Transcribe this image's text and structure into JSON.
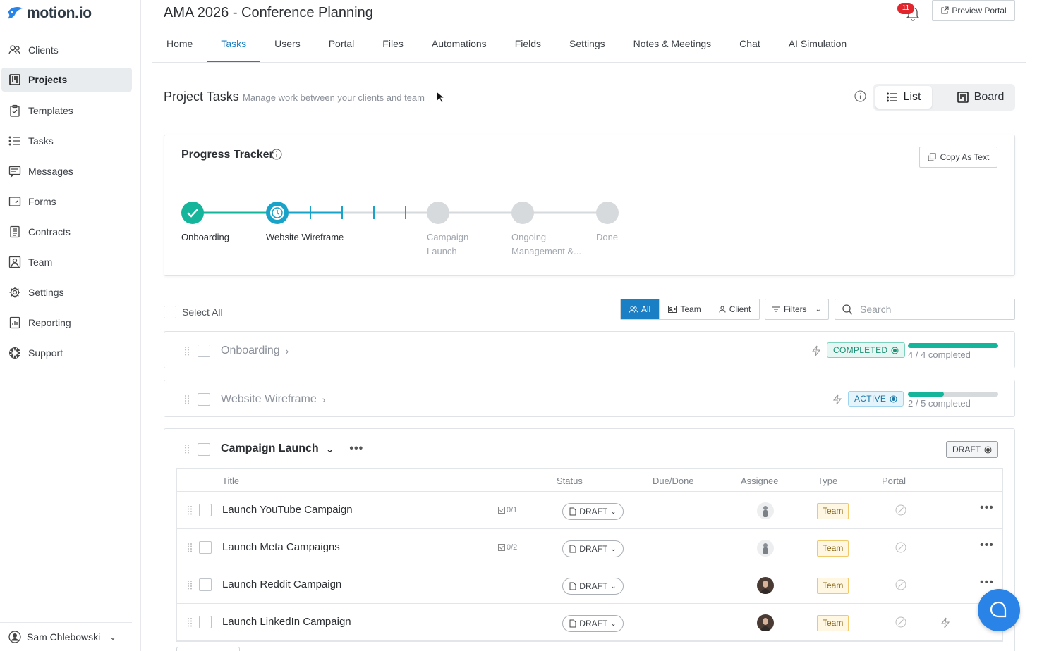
{
  "app": {
    "logo_text": "motion.io"
  },
  "sidebar": {
    "items": [
      {
        "label": "Clients",
        "icon": "users-icon"
      },
      {
        "label": "Projects",
        "icon": "board-icon",
        "active": true
      },
      {
        "label": "Templates",
        "icon": "clipboard-icon"
      },
      {
        "label": "Tasks",
        "icon": "list-icon"
      },
      {
        "label": "Messages",
        "icon": "message-icon"
      },
      {
        "label": "Forms",
        "icon": "form-icon"
      },
      {
        "label": "Contracts",
        "icon": "document-icon"
      },
      {
        "label": "Team",
        "icon": "team-icon"
      },
      {
        "label": "Settings",
        "icon": "gear-icon"
      },
      {
        "label": "Reporting",
        "icon": "chart-icon"
      },
      {
        "label": "Support",
        "icon": "lifebuoy-icon"
      }
    ],
    "user": "Sam Chlebowski"
  },
  "header": {
    "title": "AMA 2026 - Conference Planning",
    "notifications": "11",
    "preview_label": "Preview Portal",
    "tabs": [
      "Home",
      "Tasks",
      "Users",
      "Portal",
      "Files",
      "Automations",
      "Fields",
      "Settings",
      "Notes & Meetings",
      "Chat",
      "AI Simulation"
    ],
    "active_tab": "Tasks"
  },
  "project_tasks": {
    "title": "Project Tasks",
    "subtitle": "Manage work between your clients and team",
    "view_list": "List",
    "view_board": "Board"
  },
  "tracker": {
    "title": "Progress Tracker",
    "copy_label": "Copy As Text",
    "stages": [
      {
        "line1": "Onboarding",
        "line2": "",
        "state": "done"
      },
      {
        "line1": "Website Wireframe",
        "line2": "",
        "state": "active"
      },
      {
        "line1": "Campaign",
        "line2": "Launch",
        "state": "future"
      },
      {
        "line1": "Ongoing",
        "line2": "Management &...",
        "state": "future"
      },
      {
        "line1": "Done",
        "line2": "",
        "state": "future"
      }
    ]
  },
  "filters": {
    "select_all": "Select All",
    "seg": [
      "All",
      "Team",
      "Client"
    ],
    "filters_label": "Filters",
    "search_placeholder": "Search"
  },
  "phases": [
    {
      "name": "Onboarding",
      "status": "COMPLETED",
      "progress_text": "4 / 4 completed",
      "progress": 1.0
    },
    {
      "name": "Website Wireframe",
      "status": "ACTIVE",
      "progress_text": "2 / 5 completed",
      "progress": 0.4
    }
  ],
  "campaign": {
    "name": "Campaign Launch",
    "status": "DRAFT",
    "columns": [
      "Title",
      "Status",
      "Due/Done",
      "Assignee",
      "Type",
      "Portal"
    ],
    "tasks": [
      {
        "title": "Launch YouTube Campaign",
        "subtasks": "0/1",
        "status": "DRAFT",
        "type": "Team"
      },
      {
        "title": "Launch Meta Campaigns",
        "subtasks": "0/2",
        "status": "DRAFT",
        "type": "Team"
      },
      {
        "title": "Launch Reddit Campaign",
        "subtasks": "",
        "status": "DRAFT",
        "type": "Team"
      },
      {
        "title": "Launch LinkedIn Campaign",
        "subtasks": "",
        "status": "DRAFT",
        "type": "Team"
      }
    ]
  },
  "colors": {
    "accent": "#1a7fc4",
    "teal": "#14b59b",
    "brand": "#2a84e8"
  }
}
